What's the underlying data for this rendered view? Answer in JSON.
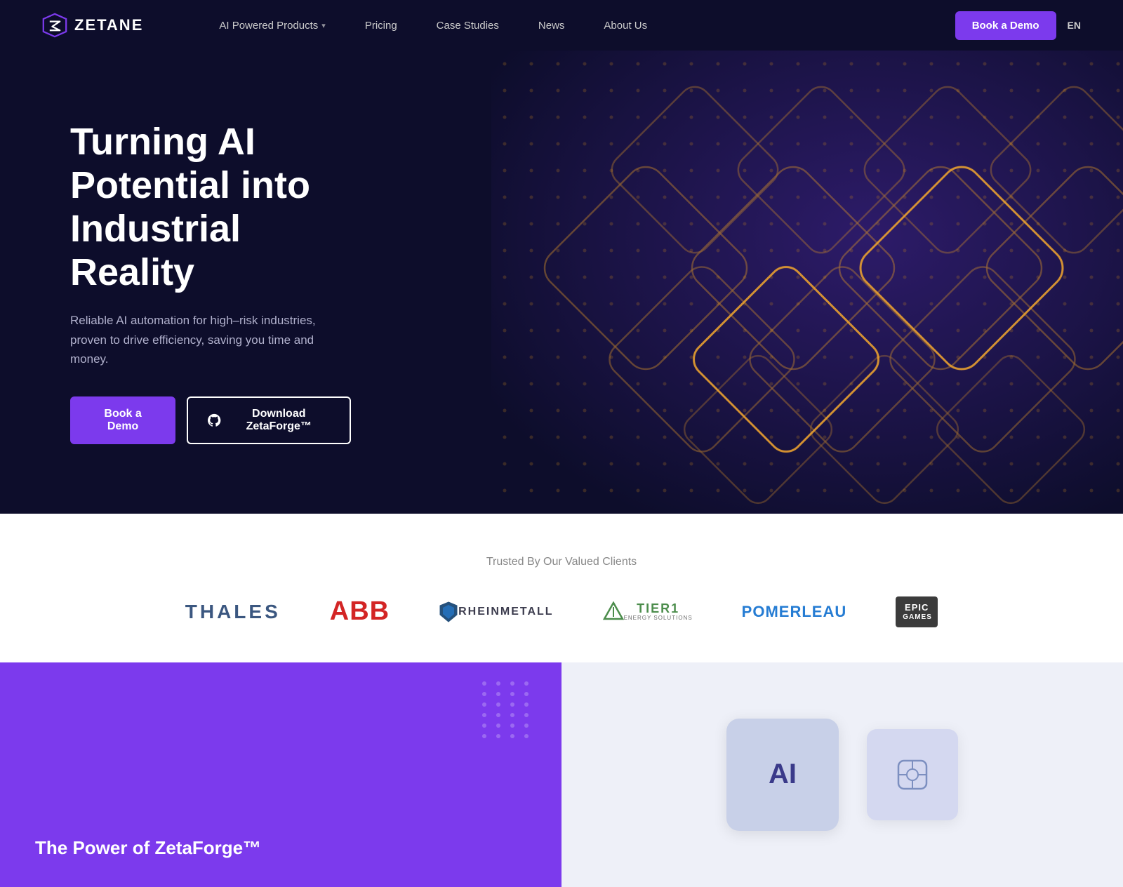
{
  "brand": {
    "name": "ZETANE",
    "logo_alt": "Zetane logo"
  },
  "nav": {
    "links": [
      {
        "label": "AI Powered Products",
        "has_dropdown": true,
        "id": "ai-products"
      },
      {
        "label": "Pricing",
        "has_dropdown": false,
        "id": "pricing"
      },
      {
        "label": "Case Studies",
        "has_dropdown": false,
        "id": "case-studies"
      },
      {
        "label": "News",
        "has_dropdown": false,
        "id": "news"
      },
      {
        "label": "About Us",
        "has_dropdown": false,
        "id": "about-us"
      }
    ],
    "cta_label": "Book a Demo",
    "lang": "EN"
  },
  "hero": {
    "title": "Turning AI Potential into Industrial Reality",
    "subtitle": "Reliable AI automation for high–risk industries, proven to drive efficiency, saving you time and money.",
    "btn_primary": "Book a Demo",
    "btn_secondary": "Download ZetaForge™"
  },
  "clients": {
    "label": "Trusted By Our Valued Clients",
    "logos": [
      {
        "name": "Thales",
        "id": "thales"
      },
      {
        "name": "ABB",
        "id": "abb"
      },
      {
        "name": "Rheinmetall",
        "id": "rheinmetall"
      },
      {
        "name": "Tier1 Energy Solutions",
        "id": "tier1"
      },
      {
        "name": "Pomerleau",
        "id": "pomerleau"
      },
      {
        "name": "Epic Games",
        "id": "epic-games"
      }
    ]
  },
  "bottom": {
    "left_title": "The Power of ZetaForge™",
    "right_alt": "AI product illustration"
  }
}
